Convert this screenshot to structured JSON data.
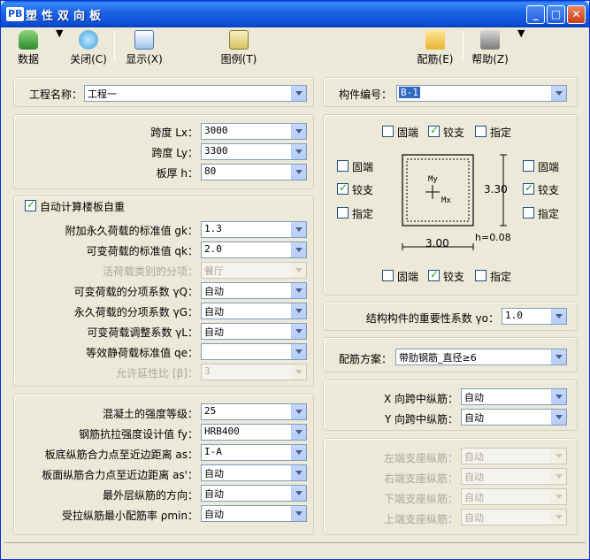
{
  "app": {
    "logo": "PB",
    "title": "塑性双向板"
  },
  "toolbar": {
    "data_label": "数据",
    "close_label": "关闭(C)",
    "display_label": "显示(X)",
    "legend_label": "图例(T)",
    "rebar_label": "配筋(E)",
    "help_label": "帮助(Z)"
  },
  "project": {
    "name_label": "工程名称：",
    "name_value": "工程一",
    "member_label": "构件编号：",
    "member_value": "B-1"
  },
  "geometry": {
    "lx_label": "跨度 Lx：",
    "lx_value": "3000",
    "ly_label": "跨度 Ly：",
    "ly_value": "3300",
    "h_label": "板厚 h：",
    "h_value": "80"
  },
  "loads": {
    "auto_selfweight_label": "自动计算楼板自重",
    "gk_label": "附加永久荷载的标准值 gk：",
    "gk_value": "1.3",
    "qk_label": "可变荷载的标准值 qk：",
    "qk_value": "2.0",
    "live_type_label": "活荷载类别的分项：",
    "live_type_value": "餐厅",
    "gamma_q_label": "可变荷载的分项系数 γQ：",
    "gamma_q_value": "自动",
    "gamma_g_label": "永久荷载的分项系数 γG：",
    "gamma_g_value": "自动",
    "gamma_l_label": "可变荷载调整系数 γL：",
    "gamma_l_value": "自动",
    "qe_label": "等效静荷载标准值 qe：",
    "qe_value": "",
    "beta_label": "允许延性比 [β]：",
    "beta_value": "3"
  },
  "material": {
    "concrete_label": "混凝土的强度等级：",
    "concrete_value": "25",
    "fy_label": "钢筋抗拉强度设计值 fy：",
    "fy_value": "HRB400",
    "as_label": "板底纵筋合力点至近边距离 as：",
    "as_value": "I-A",
    "as2_label": "板面纵筋合力点至近边距离 as'：",
    "as2_value": "自动",
    "outer_dir_label": "最外层纵筋的方向：",
    "outer_dir_value": "自动",
    "rho_min_label": "受拉纵筋最小配筋率 ρmin：",
    "rho_min_value": "自动"
  },
  "supports": {
    "fixed": "固端",
    "hinged": "铰支",
    "specified": "指定",
    "top": "hinged",
    "bottom": "hinged",
    "left": "hinged",
    "right": "hinged"
  },
  "diagram": {
    "my": "My",
    "mx": "Mx",
    "ly_dim": "3.30",
    "lx_dim": "3.00",
    "h_note": "h=0.08"
  },
  "importance": {
    "label": "结构构件的重要性系数 γo：",
    "value": "1.0"
  },
  "scheme": {
    "label": "配筋方案：",
    "value": "带肋钢筋_直径≥6"
  },
  "midspan": {
    "x_label": "X 向跨中纵筋：",
    "x_value": "自动",
    "y_label": "Y 向跨中纵筋：",
    "y_value": "自动"
  },
  "edge": {
    "left_label": "左端支座纵筋：",
    "left_value": "自动",
    "right_label": "右端支座纵筋：",
    "right_value": "自动",
    "bottom_label": "下端支座纵筋：",
    "bottom_value": "自动",
    "top_label": "上端支座纵筋：",
    "top_value": "自动"
  }
}
